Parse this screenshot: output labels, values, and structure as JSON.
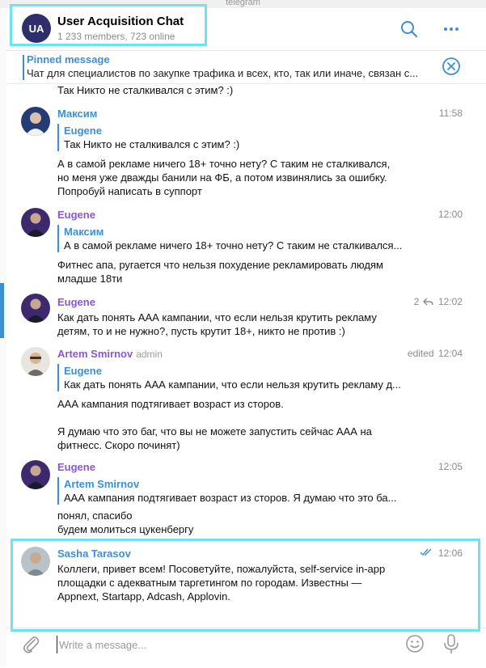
{
  "window": {
    "title": "telegram"
  },
  "header": {
    "avatar_initials": "UA",
    "title": "User Acquisition Chat",
    "subtitle": "1 233 members, 723 online",
    "icons": [
      "search-icon",
      "more-icon"
    ]
  },
  "pinned": {
    "label": "Pinned message",
    "text": "Чат для специалистов по закупке трафика и всех, кто, так или иначе, связан с...",
    "icon": "close-circle-icon"
  },
  "messages": {
    "top_fragment": "Так Никто не сталкивался с этим? :)",
    "m1": {
      "name": "Максим",
      "time": "11:58",
      "reply_name": "Eugene",
      "reply_text": "Так Никто не сталкивался с этим? :)",
      "lines": [
        "А в самой рекламе ничего 18+ точно нету? С таким не сталкивался,",
        "но меня уже дважды банили на ФБ, а потом извинялись за ошибку.",
        "Попробуй написать в суппорт"
      ]
    },
    "m2": {
      "name": "Eugene",
      "time": "12:00",
      "reply_name": "Максим",
      "reply_text": "А в самой рекламе ничего 18+ точно нету? С таким не сталкивался...",
      "lines": [
        "Фитнес апа, ругается что нельзя похудение рекламировать людям",
        "младше 18ти"
      ]
    },
    "m3": {
      "name": "Eugene",
      "time": "12:02",
      "reply_count": "2",
      "lines": [
        "Как дать понять ААА кампании, что если нельзя крутить рекламу",
        "детям, то и не нужно?, пусть крутит 18+, никто не против :)"
      ]
    },
    "m4": {
      "name": "Artem Smirnov",
      "role": "admin",
      "edited": "edited",
      "time": "12:04",
      "reply_name": "Eugene",
      "reply_text": "Как дать понять ААА кампании, что если нельзя крутить рекламу д...",
      "lines": [
        "ААА кампания подтягивает возраст из сторов.",
        "",
        "Я думаю что это баг, что вы не можете запустить сейчас ААА на",
        "фитнесс. Скоро починят)"
      ]
    },
    "m5": {
      "name": "Eugene",
      "time": "12:05",
      "reply_name": "Artem Smirnov",
      "reply_text": "ААА кампания подтягивает возраст из сторов.  Я думаю что это ба...",
      "lines": [
        "понял, спасибо",
        "будем молиться цукенбергу"
      ]
    },
    "m6": {
      "name": "Sasha Tarasov",
      "time": "12:06",
      "lines": [
        "Коллеги, привет всем! Посоветуйте, пожалуйста, self-service in-app",
        "площадки с адекватным таргетингом по городам. Известны —",
        "Appnext, Startapp, Adcash, Applovin."
      ]
    }
  },
  "composer": {
    "placeholder": "Write a message...",
    "icons": [
      "attach-icon",
      "emoji-icon",
      "microphone-icon"
    ]
  },
  "colors": {
    "accent": "#3d8fd4",
    "name_purple": "#8a56d6",
    "highlight": "#6fe1f0",
    "avatar_ua": "#2e2e6b"
  }
}
